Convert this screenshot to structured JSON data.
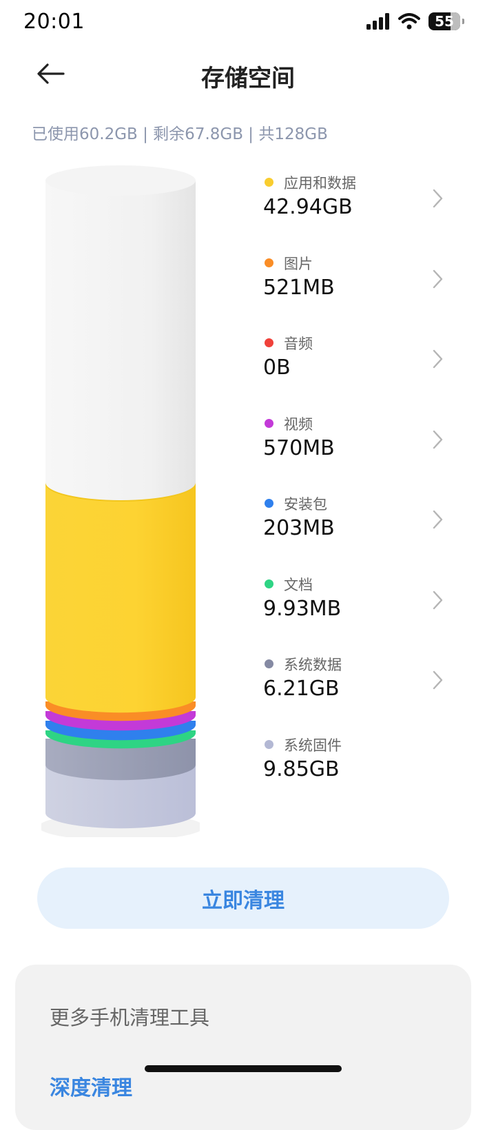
{
  "status_bar": {
    "time": "20:01",
    "battery": "55"
  },
  "header": {
    "title": "存储空间"
  },
  "summary": "已使用60.2GB | 剩余67.8GB | 共128GB",
  "categories": [
    {
      "label": "应用和数据",
      "value": "42.94GB",
      "color": "#f9cd2f",
      "has_chevron": true
    },
    {
      "label": "图片",
      "value": "521MB",
      "color": "#fa8d26",
      "has_chevron": true
    },
    {
      "label": "音频",
      "value": "0B",
      "color": "#f0413a",
      "has_chevron": true
    },
    {
      "label": "视频",
      "value": "570MB",
      "color": "#c33ad8",
      "has_chevron": true
    },
    {
      "label": "安装包",
      "value": "203MB",
      "color": "#2f80ed",
      "has_chevron": true
    },
    {
      "label": "文档",
      "value": "9.93MB",
      "color": "#2ed484",
      "has_chevron": true
    },
    {
      "label": "系统数据",
      "value": "6.21GB",
      "color": "#858aa3",
      "has_chevron": true
    },
    {
      "label": "系统固件",
      "value": "9.85GB",
      "color": "#b3b8d4",
      "has_chevron": false
    }
  ],
  "actions": {
    "clean_label": "立即清理"
  },
  "tools": {
    "title": "更多手机清理工具",
    "first_item_partial": "深度清理"
  }
}
